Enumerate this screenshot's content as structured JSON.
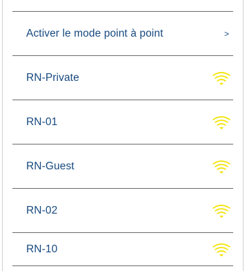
{
  "p2p_row": {
    "label": "Activer le mode point à point",
    "chevron": ">"
  },
  "networks": [
    {
      "name": "RN-Private",
      "icon": "wifi-icon"
    },
    {
      "name": "RN-01",
      "icon": "wifi-icon"
    },
    {
      "name": "RN-Guest",
      "icon": "wifi-icon"
    },
    {
      "name": "RN-02",
      "icon": "wifi-icon"
    },
    {
      "name": "RN-10",
      "icon": "wifi-icon"
    }
  ],
  "colors": {
    "label": "#17497f",
    "wifi": "#f2e300",
    "divider": "#6a6a6a"
  }
}
